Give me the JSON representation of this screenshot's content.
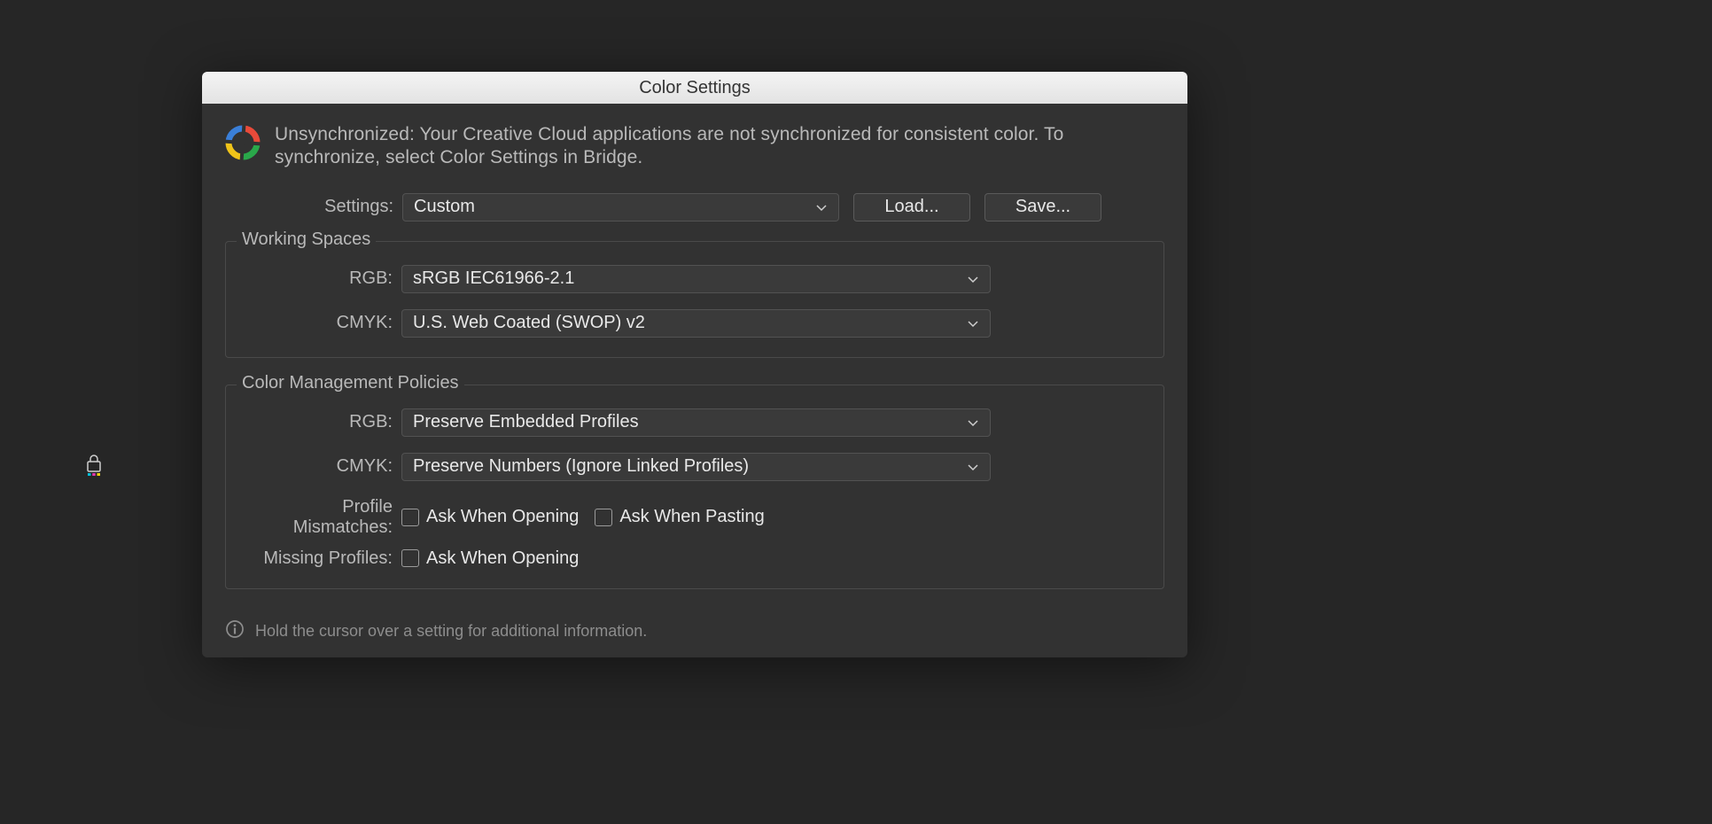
{
  "dialog": {
    "title": "Color Settings",
    "sync_message": "Unsynchronized: Your Creative Cloud applications are not synchronized for consistent color. To synchronize, select Color Settings in Bridge.",
    "settings_label": "Settings:",
    "settings_value": "Custom",
    "load_button": "Load...",
    "save_button": "Save...",
    "info_hint": "Hold the cursor over a setting for additional information."
  },
  "working_spaces": {
    "legend": "Working Spaces",
    "rgb_label": "RGB:",
    "rgb_value": "sRGB IEC61966-2.1",
    "cmyk_label": "CMYK:",
    "cmyk_value": "U.S. Web Coated (SWOP) v2"
  },
  "policies": {
    "legend": "Color Management Policies",
    "rgb_label": "RGB:",
    "rgb_value": "Preserve Embedded Profiles",
    "cmyk_label": "CMYK:",
    "cmyk_value": "Preserve Numbers (Ignore Linked Profiles)",
    "mismatches_label": "Profile Mismatches:",
    "ask_open": "Ask When Opening",
    "ask_paste": "Ask When Pasting",
    "missing_label": "Missing Profiles:",
    "ask_open2": "Ask When Opening"
  }
}
